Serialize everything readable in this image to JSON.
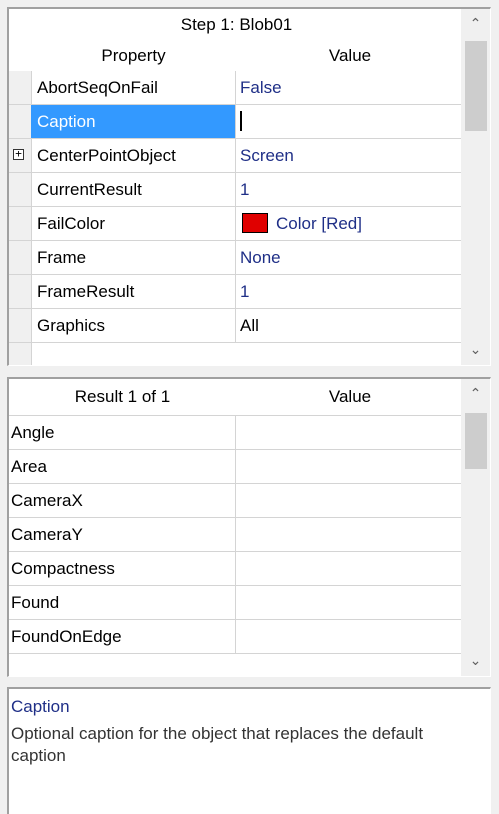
{
  "property_grid": {
    "title": "Step 1: Blob01",
    "header_property": "Property",
    "header_value": "Value",
    "rows": [
      {
        "name": "AbortSeqOnFail",
        "value": "False"
      },
      {
        "name": "Caption",
        "value": ""
      },
      {
        "name": "CenterPointObject",
        "value": "Screen"
      },
      {
        "name": "CurrentResult",
        "value": "1"
      },
      {
        "name": "FailColor",
        "value": "Color [Red]"
      },
      {
        "name": "Frame",
        "value": "None"
      },
      {
        "name": "FrameResult",
        "value": "1"
      },
      {
        "name": "Graphics",
        "value": "All"
      }
    ],
    "selected_row": "Caption",
    "fail_color_swatch": "#e00000",
    "expander_glyph": "+"
  },
  "results_grid": {
    "header_result": "Result 1 of 1",
    "header_value": "Value",
    "rows": [
      {
        "name": "Angle",
        "value": ""
      },
      {
        "name": "Area",
        "value": ""
      },
      {
        "name": "CameraX",
        "value": ""
      },
      {
        "name": "CameraY",
        "value": ""
      },
      {
        "name": "Compactness",
        "value": ""
      },
      {
        "name": "Found",
        "value": ""
      },
      {
        "name": "FoundOnEdge",
        "value": ""
      }
    ]
  },
  "description": {
    "title": "Caption",
    "text": "Optional caption for the object that replaces the default caption"
  },
  "colors": {
    "selection": "#3399ff",
    "value_text": "#1f2f87",
    "fail_color": "#e00000"
  },
  "icons": {
    "expand": "plus-box-icon",
    "scroll_up": "chevron-up-icon",
    "scroll_down": "chevron-down-icon"
  }
}
